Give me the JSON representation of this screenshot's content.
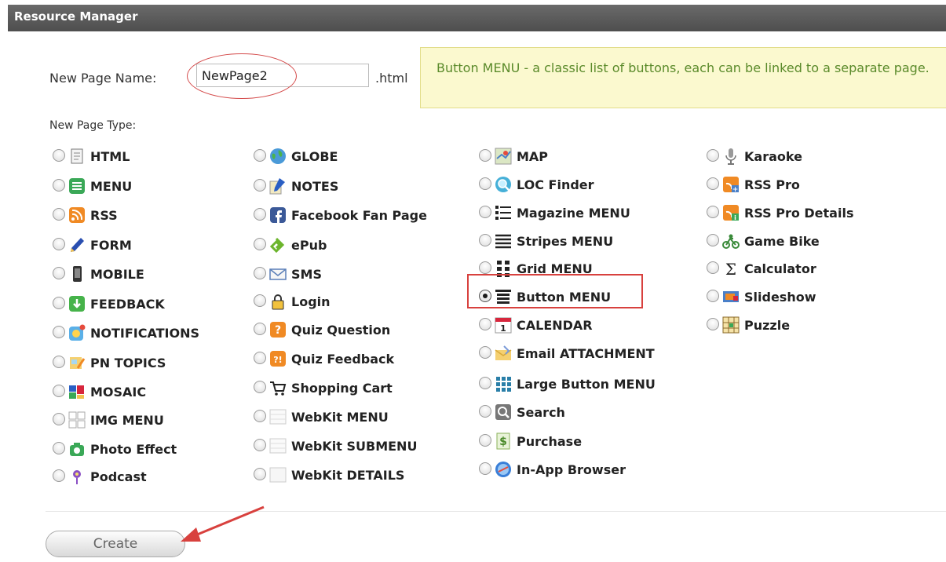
{
  "window": {
    "title": "Resource Manager"
  },
  "form": {
    "name_label": "New Page Name:",
    "name_value": "NewPage2",
    "extension": ".html",
    "description": "Button MENU - a classic list of buttons, each can be linked to a separate page.",
    "type_label": "New Page Type:"
  },
  "page_types": {
    "col1": [
      {
        "label": "HTML",
        "icon": "html-page-icon"
      },
      {
        "label": "MENU",
        "icon": "menu-list-icon"
      },
      {
        "label": "RSS",
        "icon": "rss-icon"
      },
      {
        "label": "FORM",
        "icon": "pencil-icon"
      },
      {
        "label": "MOBILE",
        "icon": "mobile-phone-icon"
      },
      {
        "label": "FEEDBACK",
        "icon": "feedback-download-icon"
      },
      {
        "label": "NOTIFICATIONS",
        "icon": "notifications-icon"
      },
      {
        "label": "PN TOPICS",
        "icon": "pn-topics-icon"
      },
      {
        "label": "MOSAIC",
        "icon": "mosaic-icon"
      },
      {
        "label": "IMG MENU",
        "icon": "image-grid-icon"
      },
      {
        "label": "Photo Effect",
        "icon": "camera-icon"
      },
      {
        "label": "Podcast",
        "icon": "podcast-icon"
      }
    ],
    "col2": [
      {
        "label": "GLOBE",
        "icon": "globe-icon"
      },
      {
        "label": "NOTES",
        "icon": "notes-icon"
      },
      {
        "label": "Facebook Fan Page",
        "icon": "facebook-icon"
      },
      {
        "label": "ePub",
        "icon": "epub-icon"
      },
      {
        "label": "SMS",
        "icon": "envelope-icon"
      },
      {
        "label": "Login",
        "icon": "lock-icon"
      },
      {
        "label": "Quiz Question",
        "icon": "quiz-question-icon"
      },
      {
        "label": "Quiz Feedback",
        "icon": "quiz-feedback-icon"
      },
      {
        "label": "Shopping Cart",
        "icon": "shopping-cart-icon"
      },
      {
        "label": "WebKit MENU",
        "icon": "webkit-menu-icon"
      },
      {
        "label": "WebKit SUBMENU",
        "icon": "webkit-submenu-icon"
      },
      {
        "label": "WebKit DETAILS",
        "icon": "webkit-details-icon"
      }
    ],
    "col3": [
      {
        "label": "MAP",
        "icon": "map-icon"
      },
      {
        "label": "LOC Finder",
        "icon": "location-finder-icon"
      },
      {
        "label": "Magazine MENU",
        "icon": "magazine-menu-icon"
      },
      {
        "label": "Stripes MENU",
        "icon": "stripes-menu-icon"
      },
      {
        "label": "Grid MENU",
        "icon": "grid-menu-icon"
      },
      {
        "label": "Button MENU",
        "icon": "button-menu-icon",
        "selected": true
      },
      {
        "label": "CALENDAR",
        "icon": "calendar-icon"
      },
      {
        "label": "Email ATTACHMENT",
        "icon": "email-attachment-icon"
      },
      {
        "label": "Large Button MENU",
        "icon": "large-button-menu-icon"
      },
      {
        "label": "Search",
        "icon": "search-icon"
      },
      {
        "label": "Purchase",
        "icon": "purchase-icon"
      },
      {
        "label": "In-App Browser",
        "icon": "browser-icon"
      }
    ],
    "col4": [
      {
        "label": "Karaoke",
        "icon": "microphone-icon"
      },
      {
        "label": "RSS Pro",
        "icon": "rss-pro-icon"
      },
      {
        "label": "RSS Pro Details",
        "icon": "rss-pro-details-icon"
      },
      {
        "label": "Game Bike",
        "icon": "game-bike-icon"
      },
      {
        "label": "Calculator",
        "icon": "sigma-icon"
      },
      {
        "label": "Slideshow",
        "icon": "slideshow-icon"
      },
      {
        "label": "Puzzle",
        "icon": "puzzle-icon"
      }
    ]
  },
  "actions": {
    "create_label": "Create"
  },
  "colors": {
    "highlight": "#d8413e",
    "description_text": "#5a8a2a",
    "description_bg": "#fbf9cf"
  }
}
